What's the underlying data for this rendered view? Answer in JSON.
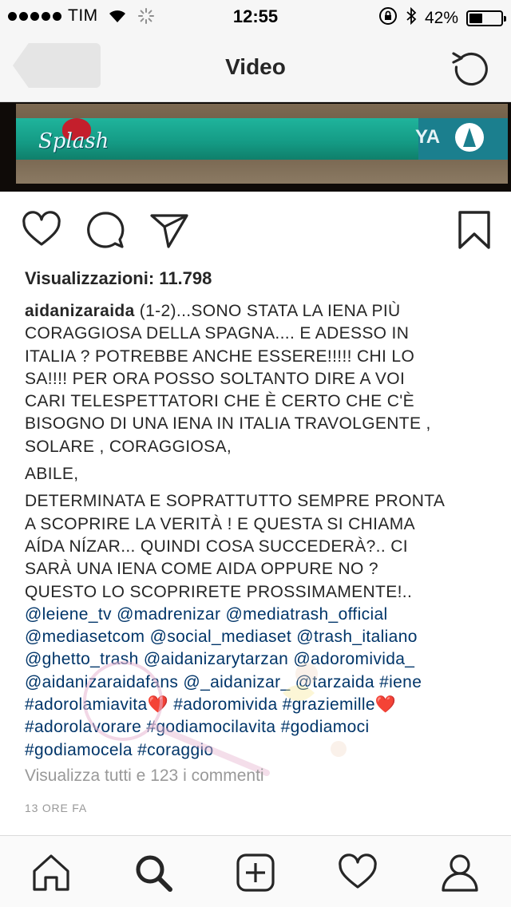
{
  "status_bar": {
    "carrier": "TIM",
    "time": "12:55",
    "battery_percent": "42%",
    "battery_level": 0.42
  },
  "nav": {
    "title": "Video"
  },
  "video": {
    "logo_text": "Splash",
    "channel_text": "YA"
  },
  "post": {
    "views_label": "Visualizzazioni: 11.798",
    "username": "aidanizaraida",
    "caption_lines": [
      " (1-2)...SONO STATA LA IENA PIÙ",
      "CORAGGIOSA DELLA SPAGNA.... E ADESSO IN",
      "ITALIA ? POTREBBE ANCHE  ESSERE!!!!! CHI LO",
      "SA!!!! PER ORA POSSO SOLTANTO  DIRE A VOI",
      "CARI TELESPETTATORI CHE  È CERTO CHE C'È",
      "BISOGNO DI UNA IENA IN ITALIA TRAVOLGENTE ,",
      "SOLARE , CORAGGIOSA,",
      "ABILE,",
      "DETERMINATA E SOPRATTUTTO SEMPRE PRONTA",
      "A SCOPRIRE LA VERITÀ ! E QUESTA SI CHIAMA",
      "AÍDA NÍZAR... QUINDI COSA SUCCEDERÀ?.. CI",
      "SARÀ UNA IENA COME AIDA OPPURE NO ?",
      "QUESTO LO SCOPRIRETE PROSSIMAMENTE!.."
    ],
    "tags": [
      "@leiene_tv",
      "@madrenizar",
      "@mediatrash_official",
      "@mediasetcom",
      "@social_mediaset",
      "@trash_italiano",
      "@ghetto_trash",
      "@aidanizarytarzan",
      "@adoromivida_",
      "@aidanizaraidafans",
      "@_aidanizar_",
      "@tarzaida",
      "#iene",
      "#adorolamiavita",
      "#adoromivida",
      "#graziemille",
      "#adorolavorare",
      "#godiamocilavita",
      "#godiamoci",
      "#godiamocela",
      "#coraggio"
    ],
    "heart_glyph": "❤️",
    "view_comments": "Visualizza tutti e 123 i commenti",
    "time_ago": "13 ORE FA"
  },
  "icons": {
    "back": "back-arrow-icon",
    "refresh": "refresh-icon",
    "like": "heart-outline-icon",
    "comment": "comment-bubble-icon",
    "share": "paper-plane-icon",
    "save": "bookmark-icon",
    "home": "home-icon",
    "search": "search-icon",
    "add": "add-post-icon",
    "activity": "heart-activity-icon",
    "profile": "profile-icon"
  },
  "colors": {
    "hashtag": "#003569",
    "text": "#262626",
    "muted": "#999999",
    "heart_emoji": "#e0242e"
  }
}
